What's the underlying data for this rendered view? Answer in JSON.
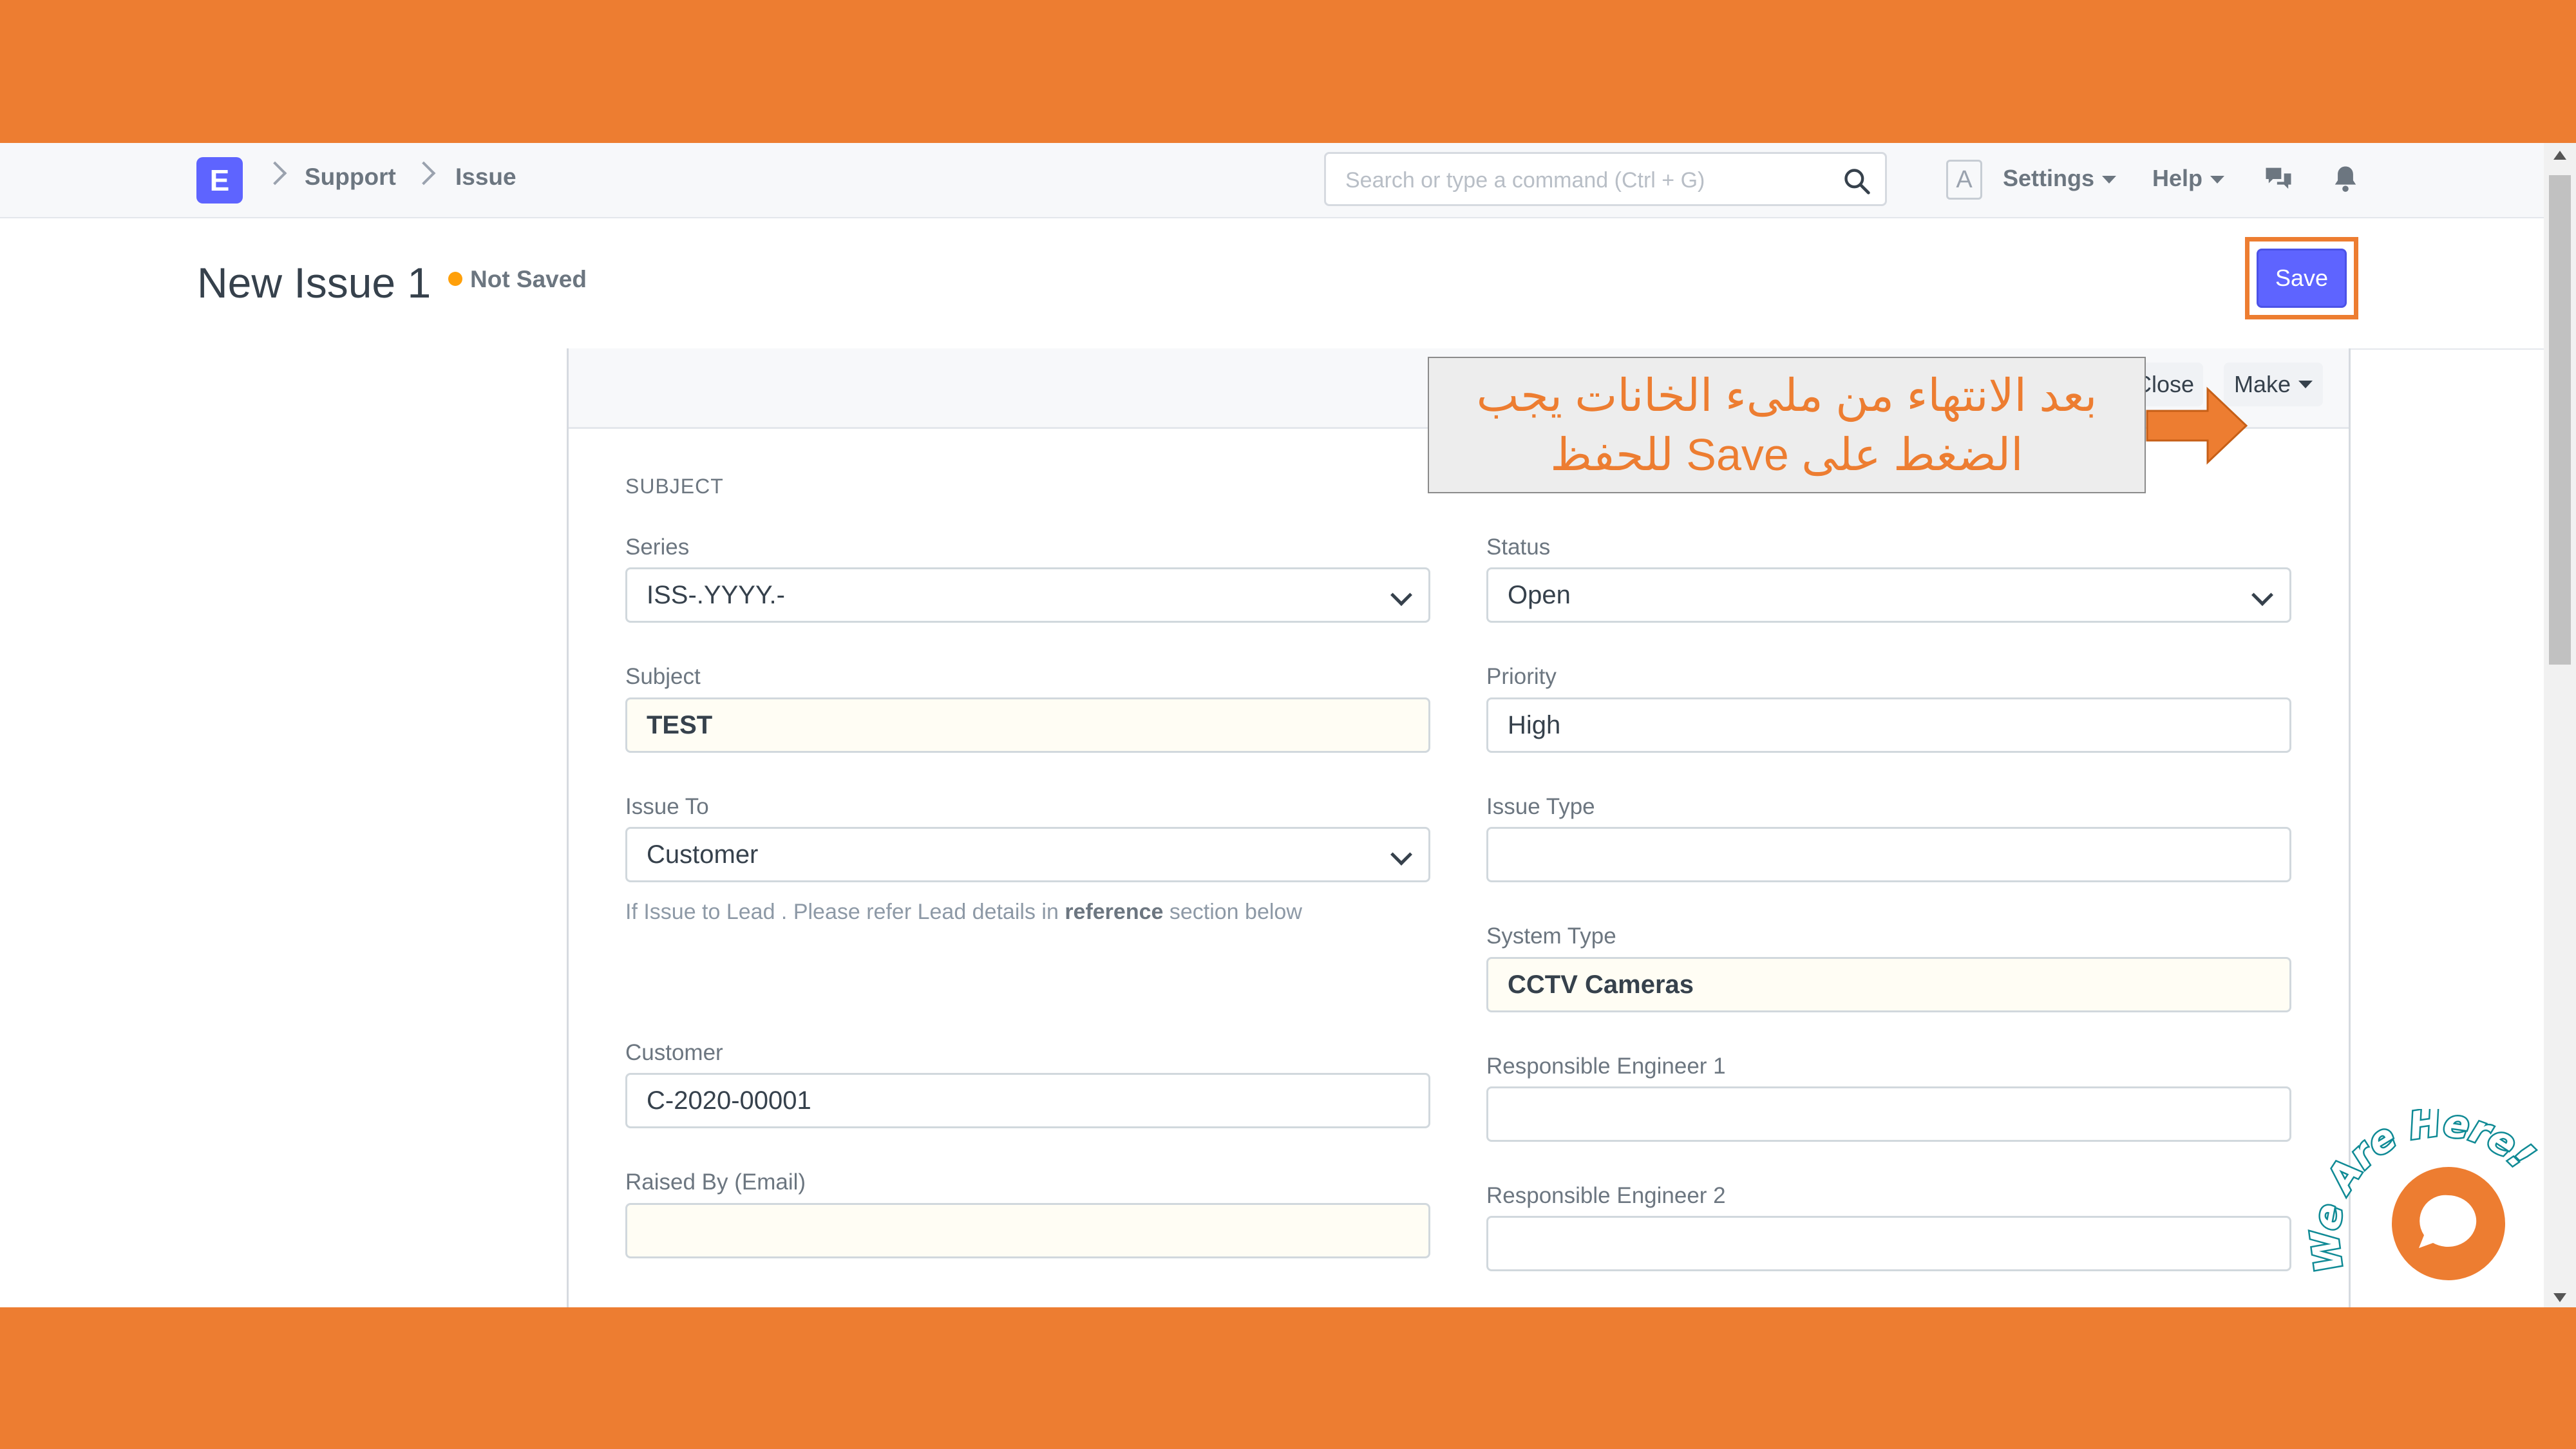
{
  "navbar": {
    "logo_letter": "E",
    "breadcrumbs": [
      "Support",
      "Issue"
    ],
    "search_placeholder": "Search or type a command (Ctrl + G)",
    "avatar_letter": "A",
    "settings_label": "Settings",
    "help_label": "Help"
  },
  "page_head": {
    "title": "New Issue 1",
    "indicator": "Not Saved",
    "save_label": "Save"
  },
  "annotation": {
    "line1": "بعد الانتهاء من ملىء الخانات يجب",
    "line2": "الضغط على Save للحفظ"
  },
  "toolbar": {
    "close_label": "Close",
    "make_label": "Make"
  },
  "form": {
    "section": "SUBJECT",
    "series": {
      "label": "Series",
      "value": "ISS-.YYYY.-"
    },
    "subject": {
      "label": "Subject",
      "value": "TEST"
    },
    "issue_to": {
      "label": "Issue To",
      "value": "Customer",
      "help_prefix": "If Issue to Lead . Please refer Lead details in ",
      "help_bold": "reference",
      "help_suffix": " section below"
    },
    "customer": {
      "label": "Customer",
      "value": "C-2020-00001"
    },
    "raised_by": {
      "label": "Raised By (Email)",
      "value": ""
    },
    "status": {
      "label": "Status",
      "value": "Open"
    },
    "priority": {
      "label": "Priority",
      "value": "High"
    },
    "issue_type": {
      "label": "Issue Type",
      "value": ""
    },
    "system_type": {
      "label": "System Type",
      "value": "CCTV Cameras"
    },
    "engineer1": {
      "label": "Responsible Engineer 1",
      "value": ""
    },
    "engineer2": {
      "label": "Responsible Engineer 2",
      "value": ""
    }
  },
  "chat_widget": {
    "tagline": "We Are Here!"
  },
  "colors": {
    "frame_orange": "#ED7D31",
    "primary": "#5E64FF",
    "required_field": "#FFFDF4",
    "indicator_orange": "#FFA00A"
  }
}
